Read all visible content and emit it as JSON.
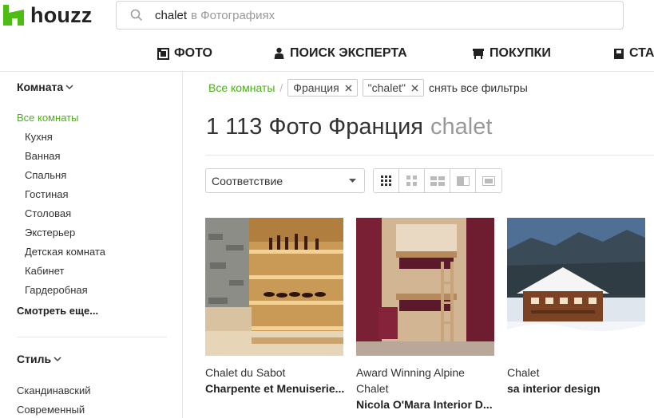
{
  "brand": {
    "logo_text": "houzz",
    "accent": "#4dbc15"
  },
  "search": {
    "term": "chalet",
    "scope": "в Фотографиях"
  },
  "nav": [
    {
      "label": "ФОТО",
      "icon": "photo-icon"
    },
    {
      "label": "ПОИСК ЭКСПЕРТА",
      "icon": "expert-icon"
    },
    {
      "label": "ПОКУПКИ",
      "icon": "shopping-icon"
    },
    {
      "label": "СТА",
      "icon": "book-icon"
    }
  ],
  "sidebar": {
    "room_heading": "Комната",
    "all_rooms": "Все комнаты",
    "rooms": [
      "Кухня",
      "Ванная",
      "Спальня",
      "Гостиная",
      "Столовая",
      "Экстерьер",
      "Детская комната",
      "Кабинет",
      "Гардеробная"
    ],
    "see_more": "Смотреть еще...",
    "style_heading": "Стиль",
    "styles": [
      "Скандинавский",
      "Современный"
    ]
  },
  "breadcrumb": {
    "root": "Все комнаты",
    "sep": "/",
    "chips": [
      "Франция",
      "\"chalet\""
    ],
    "clear": "снять все фильтры"
  },
  "heading": {
    "main": "1 113 Фото Франция",
    "muted": "chalet"
  },
  "sort": {
    "selected": "Соответствие"
  },
  "cards": [
    {
      "title": "Chalet du Sabot",
      "author": "Charpente et Menuiserie..."
    },
    {
      "title": "Award Winning Alpine Chalet",
      "title_line1": "Award Winning Alpine",
      "title_line2": "Chalet",
      "author": "Nicola O'Mara Interior D..."
    },
    {
      "title": "Chalet",
      "author": "sa interior design"
    }
  ]
}
